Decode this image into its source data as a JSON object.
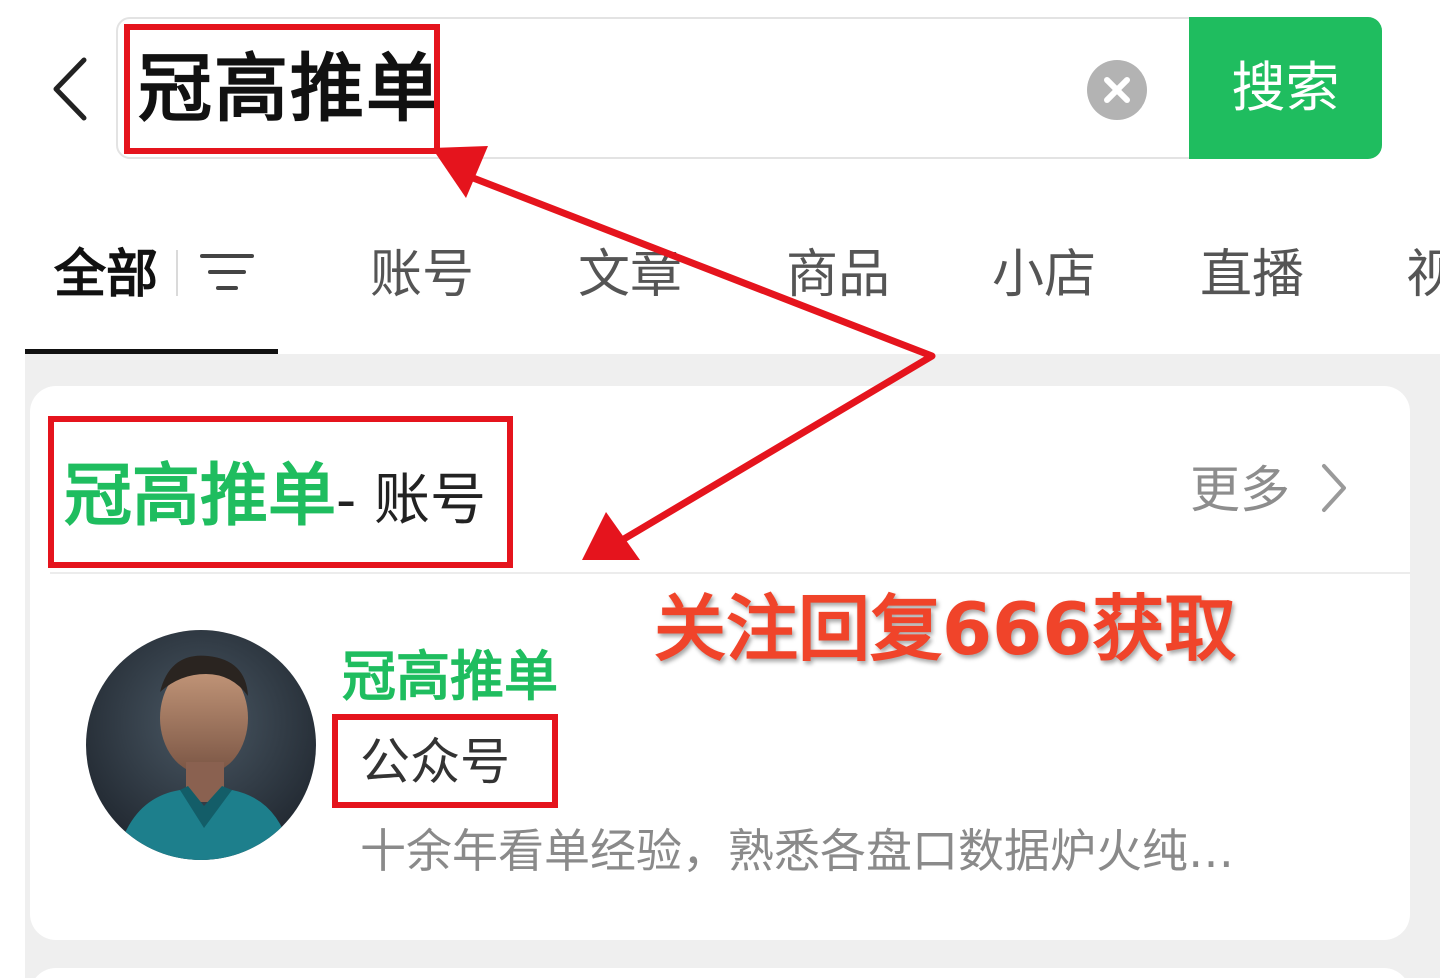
{
  "search": {
    "query": "冠高推单",
    "button_label": "搜索"
  },
  "tabs": [
    {
      "label": "全部",
      "active": true
    },
    {
      "label": "账号"
    },
    {
      "label": "文章"
    },
    {
      "label": "商品"
    },
    {
      "label": "小店"
    },
    {
      "label": "直播"
    },
    {
      "label": "视"
    }
  ],
  "section": {
    "title_highlight": "冠高推单",
    "title_suffix": "- 账号",
    "more_label": "更多"
  },
  "account": {
    "name": "冠高推单",
    "type": "公众号",
    "description": "十余年看单经验，熟悉各盘口数据炉火纯…"
  },
  "promo_text": "关注回复666获取",
  "icons": {
    "back": "chevron-left-icon",
    "clear": "clear-x-icon",
    "filter": "filter-icon",
    "more": "chevron-right-icon",
    "avatar": "avatar-image"
  },
  "colors": {
    "brand_green": "#1fbd5f",
    "annotation_red": "#e5141d",
    "promo_orange": "#f0442a"
  }
}
